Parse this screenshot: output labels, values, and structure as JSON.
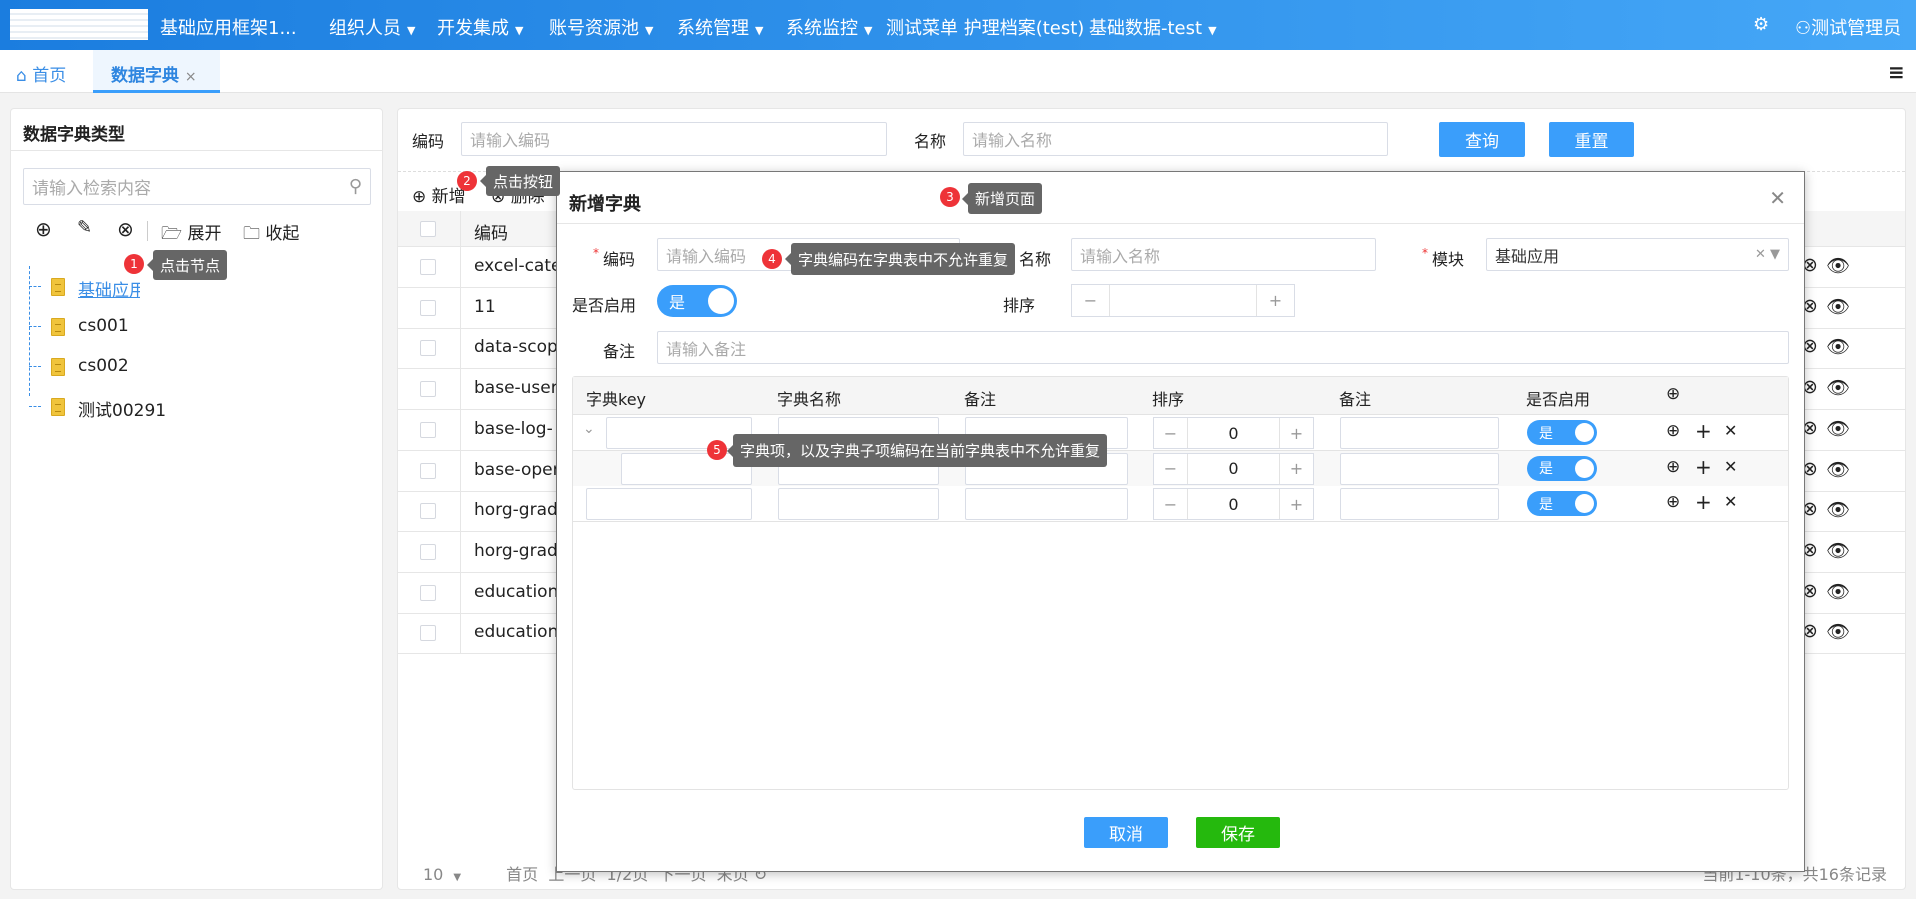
{
  "nav": {
    "title": "基础应用框架1...",
    "menus": [
      {
        "label": "组织人员",
        "dropdown": true
      },
      {
        "label": "开发集成",
        "dropdown": true
      },
      {
        "label": "账号资源池",
        "dropdown": true
      },
      {
        "label": "系统管理",
        "dropdown": true
      },
      {
        "label": "系统监控",
        "dropdown": true
      },
      {
        "label": "测试菜单 护理档案(test)",
        "dropdown": false
      },
      {
        "label": "基础数据-test",
        "dropdown": true
      }
    ],
    "user": "测试管理员",
    "settings_icon": "gear-icon",
    "user_icon": "user-icon"
  },
  "tabs": {
    "home": "首页",
    "active": "数据字典",
    "close": "×"
  },
  "left": {
    "title": "数据字典类型",
    "search_placeholder": "请输入检索内容",
    "expand": "展开",
    "collapse": "收起",
    "tree": [
      "基础应用",
      "cs001",
      "cs002",
      "测试00291"
    ]
  },
  "query": {
    "code_label": "编码",
    "code_placeholder": "请输入编码",
    "name_label": "名称",
    "name_placeholder": "请输入名称",
    "search": "查询",
    "reset": "重置"
  },
  "toolbar": {
    "add": "新增",
    "delete": "删除"
  },
  "table": {
    "header_code": "编码",
    "rows": [
      "excel-cate",
      "11",
      "data-scop",
      "base-user",
      "base-log-",
      "base-oper",
      "horg-grad",
      "horg-grad",
      "education",
      "education"
    ]
  },
  "pagination": {
    "page_size": "10",
    "first": "首页",
    "prev": "上一页",
    "page": "1/2页",
    "next": "下一页",
    "last": "末页",
    "summary": "当前1-10条，共16条记录"
  },
  "modal": {
    "title": "新增字典",
    "code_label": "编码",
    "code_placeholder": "请输入编码",
    "name_label": "名称",
    "name_placeholder": "请输入名称",
    "module_label": "模块",
    "module_value": "基础应用",
    "enabled_label": "是否启用",
    "enabled_value": "是",
    "enabled": true,
    "sort_label": "排序",
    "remark_label": "备注",
    "remark_placeholder": "请输入备注",
    "cancel": "取消",
    "save": "保存",
    "items_header": [
      "字典key",
      "字典名称",
      "备注",
      "排序",
      "备注",
      "是否启用"
    ],
    "items": [
      {
        "sort": "0",
        "enabled": "是"
      },
      {
        "sort": "0",
        "enabled": "是"
      },
      {
        "sort": "0",
        "enabled": "是"
      }
    ]
  },
  "tips": [
    {
      "n": "1",
      "text": "点击节点"
    },
    {
      "n": "2",
      "text": "点击按钮"
    },
    {
      "n": "3",
      "text": "新增页面"
    },
    {
      "n": "4",
      "text": "字典编码在字典表中不允许重复"
    },
    {
      "n": "5",
      "text": "字典项，以及字典子项编码在当前字典表中不允许重复"
    }
  ],
  "colors": {
    "primary": "#3a9efb",
    "save": "#25b90d",
    "tip": "#666666",
    "badge": "#ee3338"
  }
}
